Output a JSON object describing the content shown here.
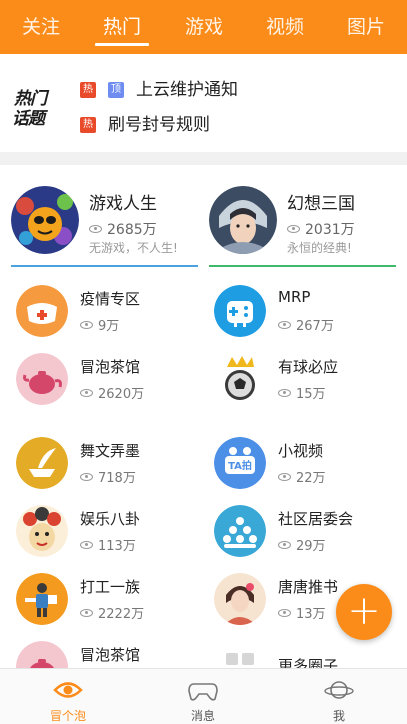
{
  "top_tabs": [
    {
      "label": "关注"
    },
    {
      "label": "热门"
    },
    {
      "label": "游戏"
    },
    {
      "label": "视频"
    },
    {
      "label": "图片"
    }
  ],
  "active_tab": "热门",
  "hot_topics": {
    "logo_line1": "热门",
    "logo_line2": "话题",
    "notices": [
      {
        "badges": [
          "热",
          "顶"
        ],
        "text": "上云维护通知"
      },
      {
        "badges": [
          "热"
        ],
        "text": "刷号封号规则"
      }
    ]
  },
  "featured": [
    {
      "name": "游戏人生",
      "views": "2685万",
      "desc": "无游戏，不人生!",
      "accent": "#4aa3df"
    },
    {
      "name": "幻想三国",
      "views": "2031万",
      "desc": "永恒的经典!",
      "accent": "#3fb86a"
    }
  ],
  "circles": [
    {
      "name": "疫情专区",
      "views": "9万",
      "icon": "mask-icon"
    },
    {
      "name": "MRP",
      "views": "267万",
      "icon": "gamepad-icon"
    },
    {
      "name": "冒泡茶馆",
      "views": "2620万",
      "icon": "teapot-icon"
    },
    {
      "name": "有球必应",
      "views": "15万",
      "icon": "soccer-ball-icon"
    },
    {
      "name": "舞文弄墨",
      "views": "718万",
      "icon": "ink-brush-icon"
    },
    {
      "name": "小视频",
      "views": "22万",
      "icon": "ta-pai-icon"
    },
    {
      "name": "娱乐八卦",
      "views": "113万",
      "icon": "opera-mask-icon"
    },
    {
      "name": "社区居委会",
      "views": "29万",
      "icon": "community-icon"
    },
    {
      "name": "打工一族",
      "views": "2222万",
      "icon": "worker-icon"
    },
    {
      "name": "唐唐推书",
      "views": "13万",
      "icon": "book-girl-icon"
    },
    {
      "name": "冒泡茶馆",
      "views": "",
      "icon": "teapot-icon"
    },
    {
      "name": "更多圈子",
      "views": "",
      "icon": "more-icon"
    }
  ],
  "ta_pai_label": "TA拍",
  "fab_label": "+",
  "bottom_nav": [
    {
      "label": "冒个泡",
      "icon": "eye-icon"
    },
    {
      "label": "消息",
      "icon": "gamepad-icon"
    },
    {
      "label": "我",
      "icon": "planet-icon"
    }
  ],
  "colors": {
    "brand": "#fb8c1a",
    "hot_badge": "#e84a2a",
    "top_badge": "#6f8df0"
  }
}
